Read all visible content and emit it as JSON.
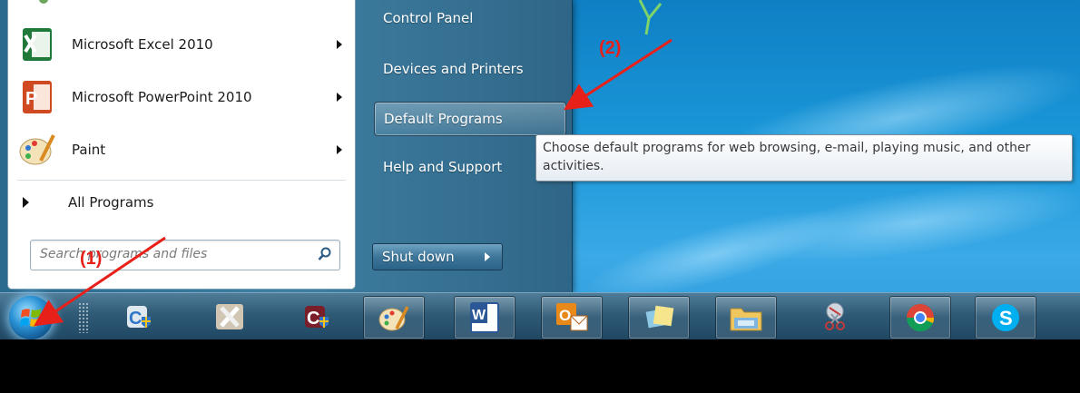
{
  "start_menu": {
    "programs": [
      {
        "label": "Microsoft Excel 2010",
        "icon": "excel-icon",
        "has_submenu": true
      },
      {
        "label": "Microsoft PowerPoint 2010",
        "icon": "powerpoint-icon",
        "has_submenu": true
      },
      {
        "label": "Paint",
        "icon": "paint-icon",
        "has_submenu": true
      }
    ],
    "all_programs": "All Programs",
    "search_placeholder": "Search programs and files",
    "right_items": [
      {
        "label": "Control Panel"
      },
      {
        "label": "Devices and Printers"
      },
      {
        "label": "Default Programs",
        "highlighted": true
      },
      {
        "label": "Help and Support"
      }
    ],
    "shutdown_label": "Shut down"
  },
  "tooltip": {
    "text": "Choose default programs for web browsing, e-mail, playing music, and other activities."
  },
  "annotations": {
    "step1": "(1)",
    "step2": "(2)",
    "color": "#e8201a"
  },
  "taskbar": {
    "buttons": [
      {
        "name": "control-panel-shield-icon"
      },
      {
        "name": "tools-icon"
      },
      {
        "name": "shield-app-icon"
      },
      {
        "name": "paint-icon"
      },
      {
        "name": "word-icon"
      },
      {
        "name": "outlook-icon"
      },
      {
        "name": "sticky-notes-icon"
      },
      {
        "name": "file-explorer-icon"
      },
      {
        "name": "snipping-tool-icon"
      },
      {
        "name": "chrome-icon"
      },
      {
        "name": "skype-icon"
      }
    ]
  },
  "colors": {
    "desktop": "#1a97d8",
    "start_menu_right": "#3f7fa2",
    "taskbar": "#2f5a76"
  }
}
